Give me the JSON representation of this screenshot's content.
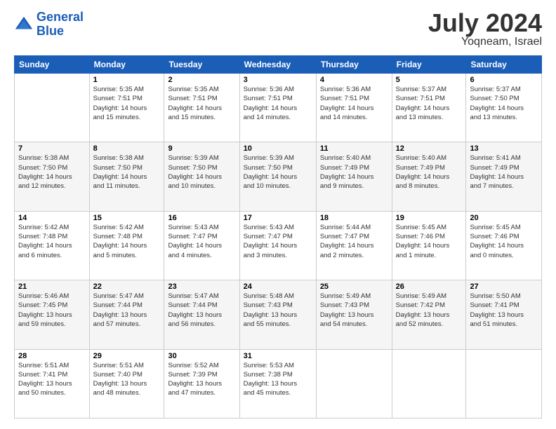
{
  "logo": {
    "line1": "General",
    "line2": "Blue"
  },
  "title": "July 2024",
  "location": "Yoqneam, Israel",
  "header_days": [
    "Sunday",
    "Monday",
    "Tuesday",
    "Wednesday",
    "Thursday",
    "Friday",
    "Saturday"
  ],
  "weeks": [
    [
      {
        "day": "",
        "text": ""
      },
      {
        "day": "1",
        "text": "Sunrise: 5:35 AM\nSunset: 7:51 PM\nDaylight: 14 hours\nand 15 minutes."
      },
      {
        "day": "2",
        "text": "Sunrise: 5:35 AM\nSunset: 7:51 PM\nDaylight: 14 hours\nand 15 minutes."
      },
      {
        "day": "3",
        "text": "Sunrise: 5:36 AM\nSunset: 7:51 PM\nDaylight: 14 hours\nand 14 minutes."
      },
      {
        "day": "4",
        "text": "Sunrise: 5:36 AM\nSunset: 7:51 PM\nDaylight: 14 hours\nand 14 minutes."
      },
      {
        "day": "5",
        "text": "Sunrise: 5:37 AM\nSunset: 7:51 PM\nDaylight: 14 hours\nand 13 minutes."
      },
      {
        "day": "6",
        "text": "Sunrise: 5:37 AM\nSunset: 7:50 PM\nDaylight: 14 hours\nand 13 minutes."
      }
    ],
    [
      {
        "day": "7",
        "text": "Sunrise: 5:38 AM\nSunset: 7:50 PM\nDaylight: 14 hours\nand 12 minutes."
      },
      {
        "day": "8",
        "text": "Sunrise: 5:38 AM\nSunset: 7:50 PM\nDaylight: 14 hours\nand 11 minutes."
      },
      {
        "day": "9",
        "text": "Sunrise: 5:39 AM\nSunset: 7:50 PM\nDaylight: 14 hours\nand 10 minutes."
      },
      {
        "day": "10",
        "text": "Sunrise: 5:39 AM\nSunset: 7:50 PM\nDaylight: 14 hours\nand 10 minutes."
      },
      {
        "day": "11",
        "text": "Sunrise: 5:40 AM\nSunset: 7:49 PM\nDaylight: 14 hours\nand 9 minutes."
      },
      {
        "day": "12",
        "text": "Sunrise: 5:40 AM\nSunset: 7:49 PM\nDaylight: 14 hours\nand 8 minutes."
      },
      {
        "day": "13",
        "text": "Sunrise: 5:41 AM\nSunset: 7:49 PM\nDaylight: 14 hours\nand 7 minutes."
      }
    ],
    [
      {
        "day": "14",
        "text": "Sunrise: 5:42 AM\nSunset: 7:48 PM\nDaylight: 14 hours\nand 6 minutes."
      },
      {
        "day": "15",
        "text": "Sunrise: 5:42 AM\nSunset: 7:48 PM\nDaylight: 14 hours\nand 5 minutes."
      },
      {
        "day": "16",
        "text": "Sunrise: 5:43 AM\nSunset: 7:47 PM\nDaylight: 14 hours\nand 4 minutes."
      },
      {
        "day": "17",
        "text": "Sunrise: 5:43 AM\nSunset: 7:47 PM\nDaylight: 14 hours\nand 3 minutes."
      },
      {
        "day": "18",
        "text": "Sunrise: 5:44 AM\nSunset: 7:47 PM\nDaylight: 14 hours\nand 2 minutes."
      },
      {
        "day": "19",
        "text": "Sunrise: 5:45 AM\nSunset: 7:46 PM\nDaylight: 14 hours\nand 1 minute."
      },
      {
        "day": "20",
        "text": "Sunrise: 5:45 AM\nSunset: 7:46 PM\nDaylight: 14 hours\nand 0 minutes."
      }
    ],
    [
      {
        "day": "21",
        "text": "Sunrise: 5:46 AM\nSunset: 7:45 PM\nDaylight: 13 hours\nand 59 minutes."
      },
      {
        "day": "22",
        "text": "Sunrise: 5:47 AM\nSunset: 7:44 PM\nDaylight: 13 hours\nand 57 minutes."
      },
      {
        "day": "23",
        "text": "Sunrise: 5:47 AM\nSunset: 7:44 PM\nDaylight: 13 hours\nand 56 minutes."
      },
      {
        "day": "24",
        "text": "Sunrise: 5:48 AM\nSunset: 7:43 PM\nDaylight: 13 hours\nand 55 minutes."
      },
      {
        "day": "25",
        "text": "Sunrise: 5:49 AM\nSunset: 7:43 PM\nDaylight: 13 hours\nand 54 minutes."
      },
      {
        "day": "26",
        "text": "Sunrise: 5:49 AM\nSunset: 7:42 PM\nDaylight: 13 hours\nand 52 minutes."
      },
      {
        "day": "27",
        "text": "Sunrise: 5:50 AM\nSunset: 7:41 PM\nDaylight: 13 hours\nand 51 minutes."
      }
    ],
    [
      {
        "day": "28",
        "text": "Sunrise: 5:51 AM\nSunset: 7:41 PM\nDaylight: 13 hours\nand 50 minutes."
      },
      {
        "day": "29",
        "text": "Sunrise: 5:51 AM\nSunset: 7:40 PM\nDaylight: 13 hours\nand 48 minutes."
      },
      {
        "day": "30",
        "text": "Sunrise: 5:52 AM\nSunset: 7:39 PM\nDaylight: 13 hours\nand 47 minutes."
      },
      {
        "day": "31",
        "text": "Sunrise: 5:53 AM\nSunset: 7:38 PM\nDaylight: 13 hours\nand 45 minutes."
      },
      {
        "day": "",
        "text": ""
      },
      {
        "day": "",
        "text": ""
      },
      {
        "day": "",
        "text": ""
      }
    ]
  ]
}
